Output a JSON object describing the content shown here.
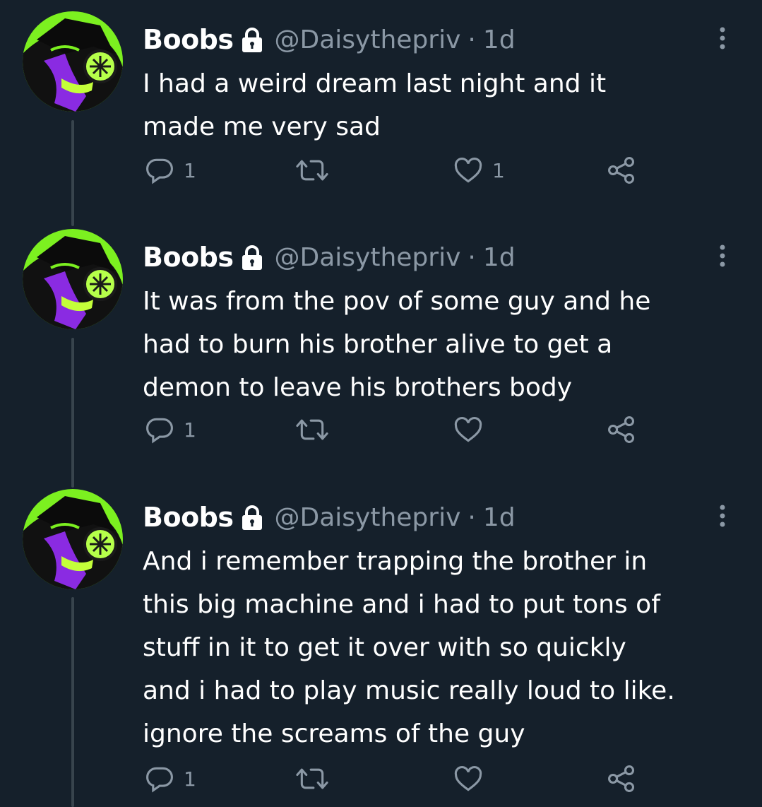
{
  "tweets": [
    {
      "name": "Boobs",
      "handle": "@Daisythepriv",
      "separator": "·",
      "time": "1d",
      "text": "I had a weird dream last night and it\nmade me very sad",
      "replies": "1",
      "retweets": "",
      "likes": "1"
    },
    {
      "name": "Boobs",
      "handle": "@Daisythepriv",
      "separator": "·",
      "time": "1d",
      "text": "It was from the pov of some guy and he\nhad to burn his brother alive to get a\ndemon to leave his brothers body",
      "replies": "1",
      "retweets": "",
      "likes": ""
    },
    {
      "name": "Boobs",
      "handle": "@Daisythepriv",
      "separator": "·",
      "time": "1d",
      "text": "And i remember trapping the brother in\nthis big machine and i had to put tons of\nstuff in it to get it over with so quickly\nand i had to play music really loud to like.\nignore the screams of the guy",
      "replies": "1",
      "retweets": "",
      "likes": ""
    }
  ],
  "icons": {
    "verified_lock": "lock-icon",
    "more": "more-icon",
    "reply": "reply-icon",
    "retweet": "retweet-icon",
    "like": "heart-icon",
    "share": "share-icon"
  },
  "colors": {
    "background": "#15202b",
    "primary_text": "#ffffff",
    "secondary_text": "#8b98a5",
    "thread_line": "#38444d",
    "avatar_green": "#7cf020",
    "avatar_purple": "#8a2be2"
  }
}
